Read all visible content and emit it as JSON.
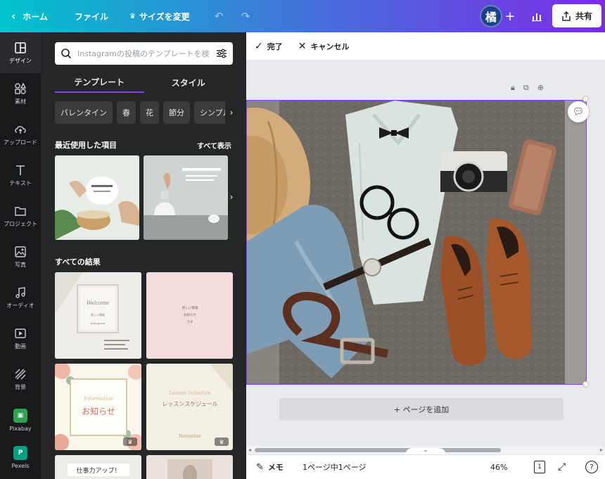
{
  "topbar": {
    "home": "ホーム",
    "file": "ファイル",
    "resize": "サイズを変更",
    "avatar_initial": "橘",
    "share": "共有",
    "brand_gradient": [
      "#00c4cc",
      "#3c7bd9",
      "#7d2ae8"
    ]
  },
  "rail": {
    "items": [
      {
        "label": "デザイン",
        "icon": "layout-icon"
      },
      {
        "label": "素材",
        "icon": "shapes-icon"
      },
      {
        "label": "アップロード",
        "icon": "cloud-upload-icon"
      },
      {
        "label": "テキスト",
        "icon": "text-icon"
      },
      {
        "label": "プロジェクト",
        "icon": "folder-icon"
      },
      {
        "label": "写真",
        "icon": "image-icon"
      },
      {
        "label": "オーディオ",
        "icon": "music-note-icon"
      },
      {
        "label": "動画",
        "icon": "video-icon"
      },
      {
        "label": "背景",
        "icon": "pattern-icon"
      },
      {
        "label": "Pixabay",
        "icon": "pixabay-logo"
      },
      {
        "label": "Pexels",
        "icon": "pexels-logo"
      }
    ]
  },
  "panel": {
    "search_placeholder": "Instagramの投稿のテンプレートを検",
    "tabs": [
      "テンプレート",
      "スタイル"
    ],
    "chips": [
      "バレンタイン",
      "春",
      "花",
      "節分",
      "シンプル"
    ],
    "recent_title": "最近使用した項目",
    "see_all": "すべて表示",
    "results_title": "すべての結果",
    "templates": [
      {
        "line1": "Welcome",
        "line2": "新しい情報",
        "line3": "Instagram"
      },
      {
        "line1": "新しい情報",
        "line2": "お知らせ",
        "line3": "です"
      },
      {
        "line1": "Information",
        "line2": "お知らせ"
      },
      {
        "line1": "Lesson Schedule",
        "line2": "レッスンスケジュール",
        "line3": "November"
      },
      {
        "line1": "仕事力アップ！"
      }
    ]
  },
  "editbar": {
    "done": "完了",
    "cancel": "キャンセル"
  },
  "canvas": {
    "add_page": "+ ページを追加"
  },
  "bottombar": {
    "notes": "メモ",
    "page_indicator": "1ページ中1ページ",
    "zoom": "46%",
    "page_count": "1",
    "help": "?"
  },
  "accent": "#8b3dff"
}
